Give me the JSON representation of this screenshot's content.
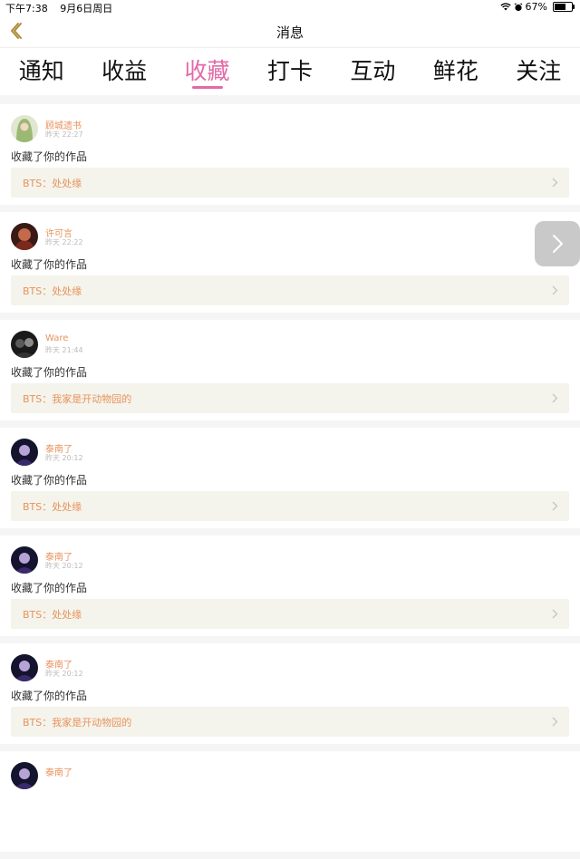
{
  "status_bar": {
    "time": "下午7:38",
    "date": "9月6日周日",
    "battery": "67%",
    "battery_level": 0.67
  },
  "header": {
    "title": "消息",
    "back_icon": "chevron-left-icon"
  },
  "tabs": [
    {
      "label": "通知",
      "active": false
    },
    {
      "label": "收益",
      "active": false
    },
    {
      "label": "收藏",
      "active": true
    },
    {
      "label": "打卡",
      "active": false
    },
    {
      "label": "互动",
      "active": false
    },
    {
      "label": "鲜花",
      "active": false
    },
    {
      "label": "关注",
      "active": false
    }
  ],
  "colors": {
    "accent": "#e26aa8",
    "name_orange": "#e8925c",
    "card_link_bg": "#f4f4ec"
  },
  "notifications": [
    {
      "user": "顾城遗书",
      "time": "昨天 22:27",
      "action": "收藏了你的作品",
      "work": "BTS：处处缘"
    },
    {
      "user": "许可言",
      "time": "昨天 22:22",
      "action": "收藏了你的作品",
      "work": "BTS：处处缘"
    },
    {
      "user": "Ware",
      "time": "昨天 21:44",
      "action": "收藏了你的作品",
      "work": "BTS：我家是开动物园的"
    },
    {
      "user": "泰南了",
      "time": "昨天 20:12",
      "action": "收藏了你的作品",
      "work": "BTS：处处缘"
    },
    {
      "user": "泰南了",
      "time": "昨天 20:12",
      "action": "收藏了你的作品",
      "work": "BTS：处处缘"
    },
    {
      "user": "泰南了",
      "time": "昨天 20:12",
      "action": "收藏了你的作品",
      "work": "BTS：我家是开动物园的"
    },
    {
      "user": "泰南了",
      "time": "",
      "action": "",
      "work": ""
    }
  ],
  "floating_button": {
    "icon": "chevron-right-icon"
  }
}
